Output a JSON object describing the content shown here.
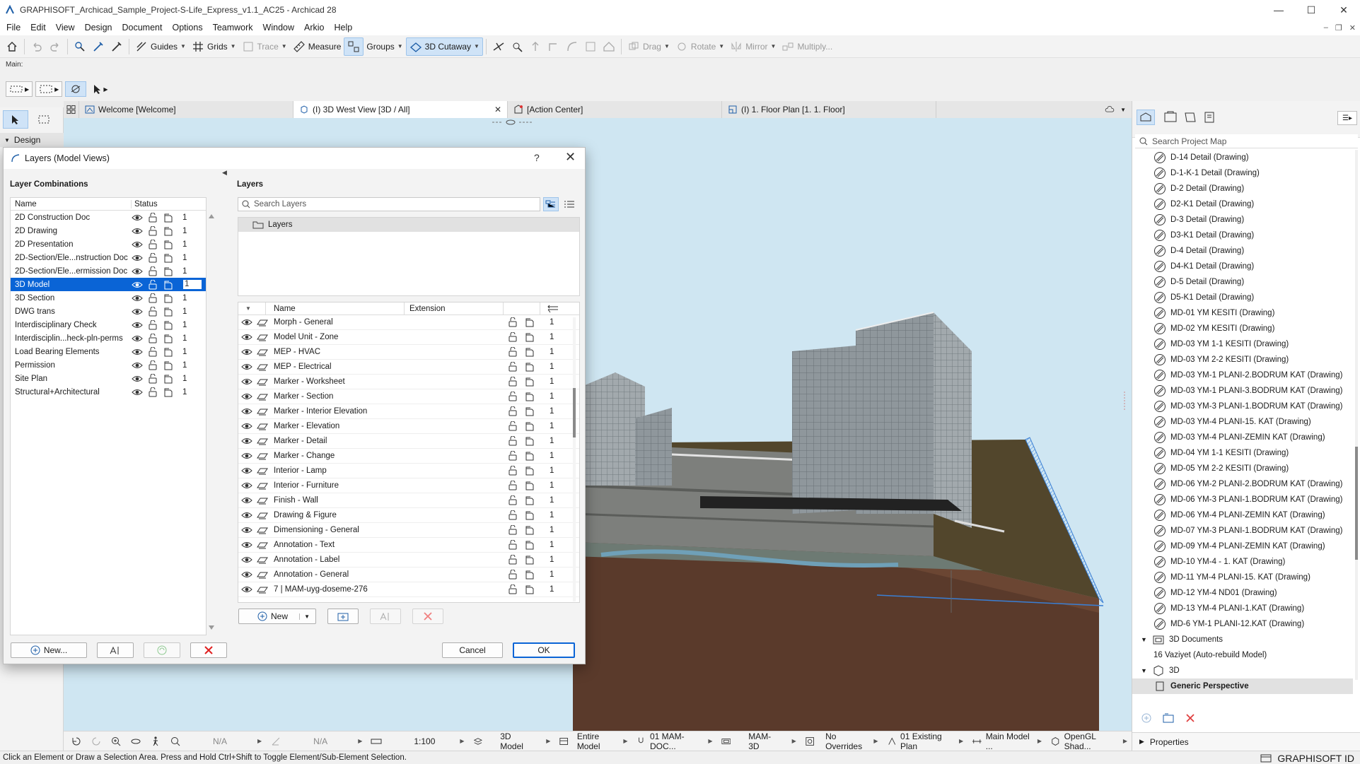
{
  "window": {
    "title": "GRAPHISOFT_Archicad_Sample_Project-S-Life_Express_v1.1_AC25 - Archicad 28"
  },
  "menu": [
    "File",
    "Edit",
    "View",
    "Design",
    "Document",
    "Options",
    "Teamwork",
    "Window",
    "Arkio",
    "Help"
  ],
  "toolbar": {
    "guides": "Guides",
    "grids": "Grids",
    "trace": "Trace",
    "measure": "Measure",
    "groups": "Groups",
    "cutaway": "3D Cutaway",
    "drag": "Drag",
    "rotate": "Rotate",
    "mirror": "Mirror",
    "multiply": "Multiply..."
  },
  "infobox": {
    "label": "Main:"
  },
  "toolbox": {
    "section": "Design"
  },
  "tabs": [
    {
      "label": "Welcome [Welcome]"
    },
    {
      "label": "(I) 3D West View [3D / All]"
    },
    {
      "label": "[Action Center]"
    },
    {
      "label": "(I) 1. Floor Plan [1. 1. Floor]"
    }
  ],
  "dialog": {
    "title": "Layers (Model Views)",
    "help": "?",
    "combinations_header": "Layer Combinations",
    "col_name": "Name",
    "col_status": "Status",
    "combinations": [
      {
        "name": "2D Construction Doc",
        "count": "1"
      },
      {
        "name": "2D Drawing",
        "count": "1"
      },
      {
        "name": "2D Presentation",
        "count": "1"
      },
      {
        "name": "2D-Section/Ele...nstruction Doc",
        "count": "1"
      },
      {
        "name": "2D-Section/Ele...ermission Doc",
        "count": "1"
      },
      {
        "name": "3D Model",
        "count": "1"
      },
      {
        "name": "3D Section",
        "count": "1"
      },
      {
        "name": "DWG trans",
        "count": "1"
      },
      {
        "name": "Interdisciplinary Check",
        "count": "1"
      },
      {
        "name": "Interdisciplin...heck-pln-perms",
        "count": "1"
      },
      {
        "name": "Load Bearing Elements",
        "count": "1"
      },
      {
        "name": "Permission",
        "count": "1"
      },
      {
        "name": "Site Plan",
        "count": "1"
      },
      {
        "name": "Structural+Architectural",
        "count": "1"
      }
    ],
    "combo_new": "New...",
    "layers_header": "Layers",
    "search_placeholder": "Search Layers",
    "folder": "Layers",
    "col_layer_name": "Name",
    "col_extension": "Extension",
    "layers": [
      {
        "name": "Morph - General",
        "count": "1"
      },
      {
        "name": "Model Unit - Zone",
        "count": "1"
      },
      {
        "name": "MEP - HVAC",
        "count": "1"
      },
      {
        "name": "MEP - Electrical",
        "count": "1"
      },
      {
        "name": "Marker - Worksheet",
        "count": "1"
      },
      {
        "name": "Marker - Section",
        "count": "1"
      },
      {
        "name": "Marker - Interior Elevation",
        "count": "1"
      },
      {
        "name": "Marker - Elevation",
        "count": "1"
      },
      {
        "name": "Marker - Detail",
        "count": "1"
      },
      {
        "name": "Marker - Change",
        "count": "1"
      },
      {
        "name": "Interior - Lamp",
        "count": "1"
      },
      {
        "name": "Interior - Furniture",
        "count": "1"
      },
      {
        "name": "Finish - Wall",
        "count": "1"
      },
      {
        "name": "Drawing & Figure",
        "count": "1"
      },
      {
        "name": "Dimensioning - General",
        "count": "1"
      },
      {
        "name": "Annotation - Text",
        "count": "1"
      },
      {
        "name": "Annotation - Label",
        "count": "1"
      },
      {
        "name": "Annotation - General",
        "count": "1"
      },
      {
        "name": "7 | MAM-uyg-doseme-276",
        "count": "1"
      }
    ],
    "layer_new": "New",
    "cancel": "Cancel",
    "ok": "OK"
  },
  "project_map": {
    "search_placeholder": "Search Project Map",
    "items": [
      {
        "label": "D-14 Detail (Drawing)",
        "kind": "drawing"
      },
      {
        "label": "D-1-K-1 Detail (Drawing)",
        "kind": "drawing"
      },
      {
        "label": "D-2 Detail (Drawing)",
        "kind": "drawing"
      },
      {
        "label": "D2-K1 Detail (Drawing)",
        "kind": "drawing"
      },
      {
        "label": "D-3 Detail (Drawing)",
        "kind": "drawing"
      },
      {
        "label": "D3-K1 Detail (Drawing)",
        "kind": "drawing"
      },
      {
        "label": "D-4 Detail (Drawing)",
        "kind": "drawing"
      },
      {
        "label": "D4-K1 Detail (Drawing)",
        "kind": "drawing"
      },
      {
        "label": "D-5 Detail (Drawing)",
        "kind": "drawing"
      },
      {
        "label": "D5-K1 Detail (Drawing)",
        "kind": "drawing"
      },
      {
        "label": "MD-01 YM KESITI (Drawing)",
        "kind": "drawing"
      },
      {
        "label": "MD-02 YM KESITI (Drawing)",
        "kind": "drawing"
      },
      {
        "label": "MD-03 YM 1-1 KESITI (Drawing)",
        "kind": "drawing"
      },
      {
        "label": "MD-03 YM 2-2 KESITI (Drawing)",
        "kind": "drawing"
      },
      {
        "label": "MD-03 YM-1 PLANI-2.BODRUM KAT (Drawing)",
        "kind": "drawing"
      },
      {
        "label": "MD-03 YM-1 PLANI-3.BODRUM KAT (Drawing)",
        "kind": "drawing"
      },
      {
        "label": "MD-03 YM-3 PLANI-1.BODRUM KAT (Drawing)",
        "kind": "drawing"
      },
      {
        "label": "MD-03 YM-4 PLANI-15. KAT (Drawing)",
        "kind": "drawing"
      },
      {
        "label": "MD-03 YM-4 PLANI-ZEMIN KAT (Drawing)",
        "kind": "drawing"
      },
      {
        "label": "MD-04 YM 1-1 KESITI (Drawing)",
        "kind": "drawing"
      },
      {
        "label": "MD-05 YM 2-2 KESITI (Drawing)",
        "kind": "drawing"
      },
      {
        "label": "MD-06 YM-2 PLANI-2.BODRUM KAT (Drawing)",
        "kind": "drawing"
      },
      {
        "label": "MD-06 YM-3 PLANI-1.BODRUM KAT (Drawing)",
        "kind": "drawing"
      },
      {
        "label": "MD-06 YM-4 PLANI-ZEMIN KAT (Drawing)",
        "kind": "drawing"
      },
      {
        "label": "MD-07 YM-3 PLANI-1.BODRUM KAT (Drawing)",
        "kind": "drawing"
      },
      {
        "label": "MD-09 YM-4 PLANI-ZEMIN KAT (Drawing)",
        "kind": "drawing"
      },
      {
        "label": "MD-10 YM-4 - 1. KAT (Drawing)",
        "kind": "drawing"
      },
      {
        "label": "MD-11 YM-4 PLANI-15. KAT (Drawing)",
        "kind": "drawing"
      },
      {
        "label": "MD-12 YM-4 ND01 (Drawing)",
        "kind": "drawing"
      },
      {
        "label": "MD-13 YM-4 PLANI-1.KAT (Drawing)",
        "kind": "drawing"
      },
      {
        "label": "MD-6 YM-1 PLANI-12.KAT (Drawing)",
        "kind": "drawing"
      },
      {
        "label": "3D Documents",
        "kind": "folder"
      },
      {
        "label": "16 Vaziyet (Auto-rebuild Model)",
        "kind": "doc"
      },
      {
        "label": "3D",
        "kind": "folder3d"
      },
      {
        "label": "Generic Perspective",
        "kind": "view"
      }
    ],
    "properties": "Properties"
  },
  "navbar": {
    "na1": "N/A",
    "na2": "N/A",
    "scale": "1:100",
    "layer_combo": "3D Model",
    "model_view": "Entire Model",
    "pen_set": "01 MAM-DOC...",
    "mvo": "MAM-3D",
    "override": "No Overrides",
    "renovation": "01 Existing Plan",
    "dim": "Main Model ...",
    "engine": "OpenGL Shad..."
  },
  "status": {
    "message": "Click an Element or Draw a Selection Area. Press and Hold Ctrl+Shift to Toggle Element/Sub-Element Selection.",
    "brand": "GRAPHISOFT ID"
  },
  "colors": {
    "selection": "#0a64d6",
    "sky": "#cfe6f2",
    "terrain": "#52462c",
    "soil": "#5a3a2b"
  }
}
